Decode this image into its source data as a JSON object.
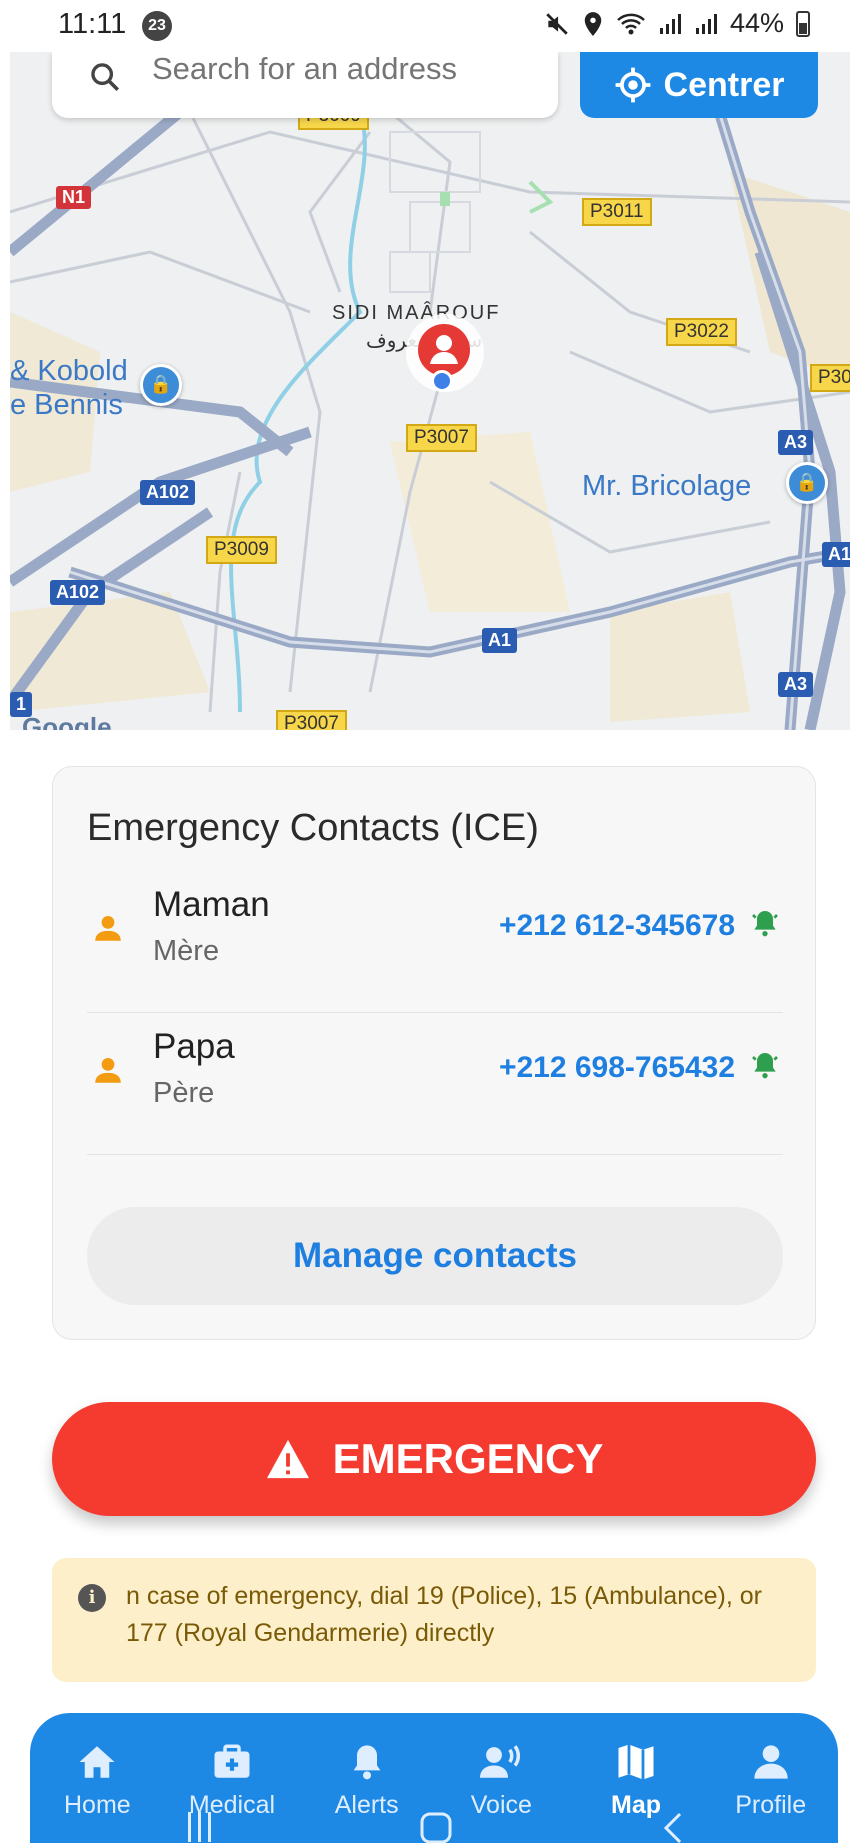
{
  "status_bar": {
    "time": "11:11",
    "notification_count": "23",
    "battery": "44%"
  },
  "map": {
    "search": {
      "placeholder": "Search for an address"
    },
    "centrer_label": "Centrer",
    "google_attribution": "Google",
    "place_name": "SIDI MAÂROUF",
    "place_name_arabic": "سيدي معروف",
    "poi_kobold": "& Kobold e Bennis",
    "poi_bricolage": "Mr. Bricolage",
    "roads": {
      "p3009_top": "P3009",
      "p3011": "P3011",
      "p3022": "P3022",
      "p30": "P30",
      "p3007_mid": "P3007",
      "p3009_bottom": "P3009",
      "p3007_bottom": "P3007",
      "n1": "N1",
      "a102_upper": "A102",
      "a102_lower": "A102",
      "a1": "A1",
      "a3_upper": "A3",
      "a3_lower": "A3",
      "a1_right": "A1",
      "left_edge": "1"
    }
  },
  "ice_card": {
    "title": "Emergency Contacts (ICE)",
    "contacts": [
      {
        "name": "Maman",
        "relation": "Mère",
        "phone": "+212 612-345678"
      },
      {
        "name": "Papa",
        "relation": "Père",
        "phone": "+212 698-765432"
      }
    ],
    "manage_label": "Manage contacts"
  },
  "emergency_button": {
    "label": "EMERGENCY"
  },
  "info_banner": {
    "text": "n case of emergency, dial 19 (Police), 15 (Ambulance), or 177 (Royal Gendarmerie) directly"
  },
  "bottom_nav": {
    "items": [
      {
        "label": "Home",
        "icon": "home-icon"
      },
      {
        "label": "Medical",
        "icon": "medical-kit-icon"
      },
      {
        "label": "Alerts",
        "icon": "bell-icon"
      },
      {
        "label": "Voice",
        "icon": "voice-icon"
      },
      {
        "label": "Map",
        "icon": "map-icon",
        "active": true
      },
      {
        "label": "Profile",
        "icon": "profile-icon"
      }
    ]
  },
  "colors": {
    "primary": "#1e88e5",
    "emergency": "#f53b30",
    "info_bg": "#fcefc9",
    "alert_green": "#2e9e4f",
    "contact_orange": "#f39c12"
  }
}
